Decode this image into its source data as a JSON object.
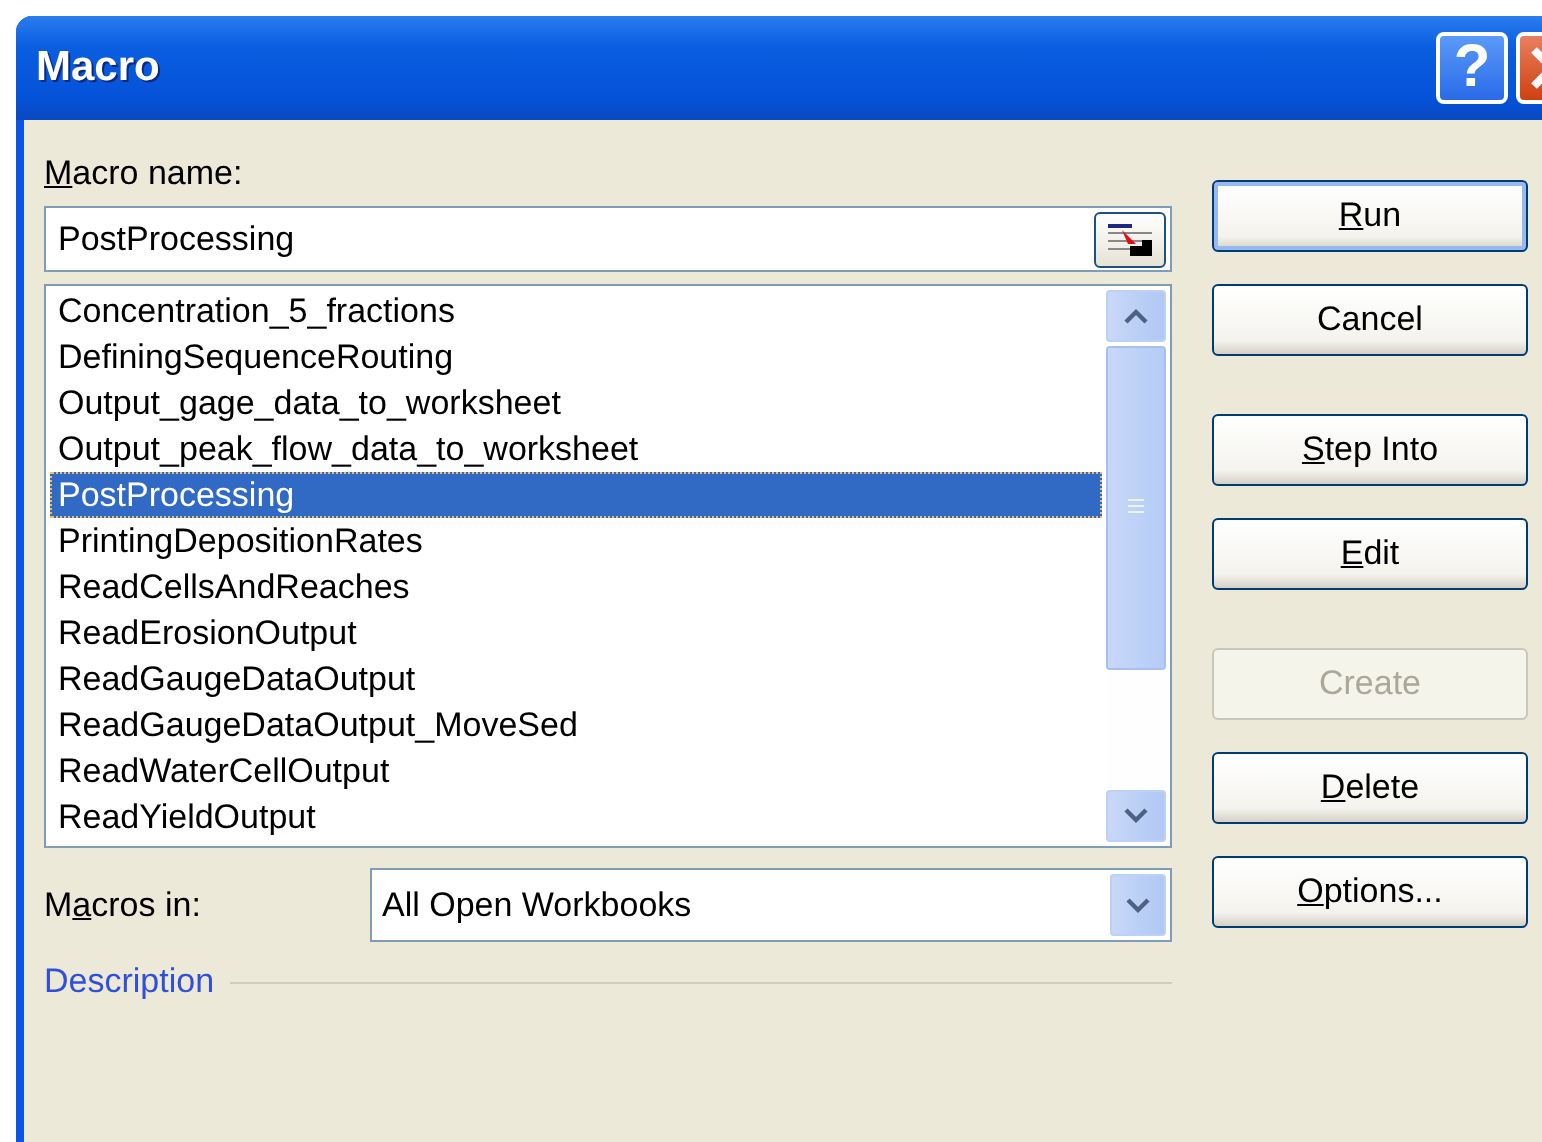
{
  "window": {
    "title": "Macro"
  },
  "title_buttons": [
    {
      "kind": "help",
      "label": "?"
    },
    {
      "kind": "close"
    }
  ],
  "macro_name": {
    "label": {
      "key": "M",
      "post": "acro name:"
    },
    "value": "PostProcessing"
  },
  "macro_list": [
    {
      "name": "Concentration_5_fractions",
      "selected": false
    },
    {
      "name": "DefiningSequenceRouting",
      "selected": false
    },
    {
      "name": "Output_gage_data_to_worksheet",
      "selected": false
    },
    {
      "name": "Output_peak_flow_data_to_worksheet",
      "selected": false
    },
    {
      "name": "PostProcessing",
      "selected": true
    },
    {
      "name": "PrintingDepositionRates",
      "selected": false
    },
    {
      "name": "ReadCellsAndReaches",
      "selected": false
    },
    {
      "name": "ReadErosionOutput",
      "selected": false
    },
    {
      "name": "ReadGaugeDataOutput",
      "selected": false
    },
    {
      "name": "ReadGaugeDataOutput_MoveSed",
      "selected": false
    },
    {
      "name": "ReadWaterCellOutput",
      "selected": false
    },
    {
      "name": "ReadYieldOutput",
      "selected": false
    }
  ],
  "macros_in": {
    "label": {
      "pre": "M",
      "key": "a",
      "post": "cros in:"
    },
    "value": "All Open Workbooks"
  },
  "description": {
    "label": "Description"
  },
  "button_groups": [
    [
      {
        "key": "R",
        "post": "un",
        "disabled": false,
        "default": true
      },
      {
        "pre": "Cancel",
        "disabled": false,
        "default": false
      }
    ],
    [
      {
        "key": "S",
        "post": "tep Into",
        "disabled": false,
        "default": false
      },
      {
        "key": "E",
        "post": "dit",
        "disabled": false,
        "default": false
      }
    ],
    [
      {
        "pre": "Create",
        "disabled": true,
        "default": false
      },
      {
        "key": "D",
        "post": "elete",
        "disabled": false,
        "default": false
      },
      {
        "key": "O",
        "post": "ptions...",
        "disabled": false,
        "default": false
      }
    ]
  ]
}
